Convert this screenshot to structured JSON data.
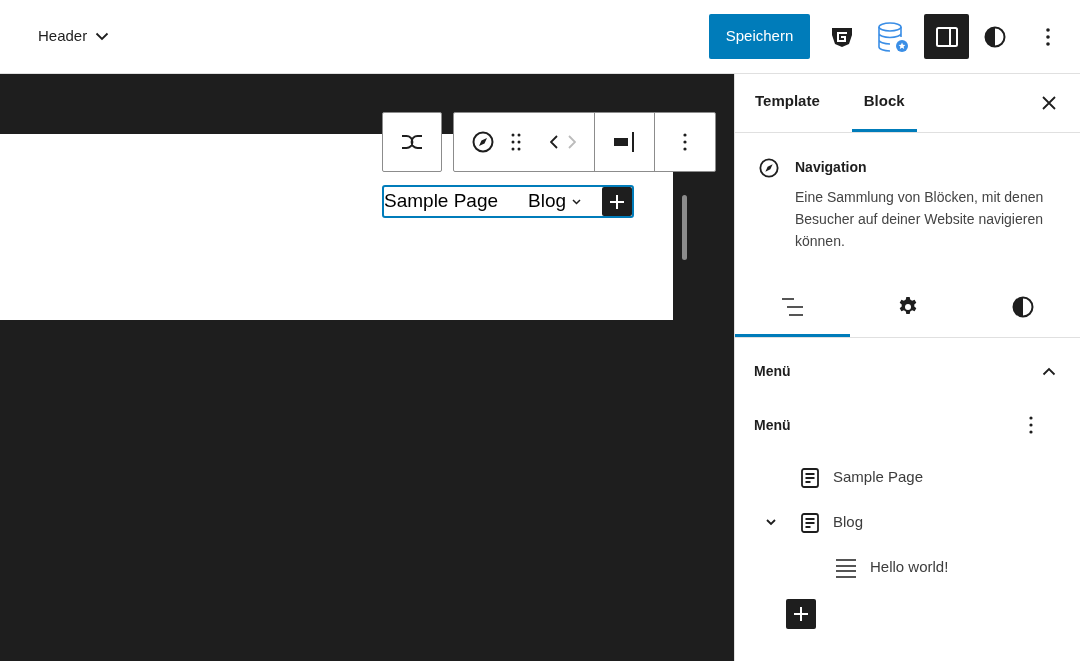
{
  "header": {
    "template_name": "Header",
    "save_button": "Speichern",
    "sidebar_toggle": {
      "pressed": true
    }
  },
  "canvas": {
    "nav_items": [
      {
        "label": "Sample Page",
        "has_submenu": false
      },
      {
        "label": "Blog",
        "has_submenu": true
      }
    ]
  },
  "sidebar": {
    "tabs": [
      {
        "label": "Template",
        "selected": false
      },
      {
        "label": "Block",
        "selected": true
      }
    ],
    "block": {
      "title": "Navigation",
      "description": "Eine Sammlung von Blöcken, mit denen Besucher auf deiner Website navigieren können."
    },
    "subtabs": [
      {
        "kind": "list",
        "selected": true
      },
      {
        "kind": "settings",
        "selected": false
      },
      {
        "kind": "styles",
        "selected": false
      }
    ],
    "panel": {
      "title": "Menü",
      "expanded": true
    },
    "menu": {
      "title": "Menü",
      "items": [
        {
          "label": "Sample Page",
          "kind": "page"
        },
        {
          "label": "Blog",
          "kind": "page",
          "expanded": true,
          "children": [
            {
              "label": "Hello world!",
              "kind": "post"
            }
          ]
        }
      ]
    }
  }
}
